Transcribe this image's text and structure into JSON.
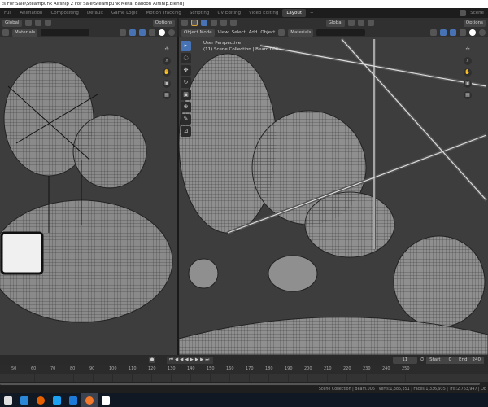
{
  "title": "ts For Sale\\Steampunk Airship 2 For Sale\\Steampunk Metal Balloon Airship.blend]",
  "workspaces": [
    "Full",
    "Animation",
    "Compositing",
    "Default",
    "Game Logic",
    "Motion Tracking",
    "Scripting",
    "UV Editing",
    "Video Editing",
    "Layout"
  ],
  "active_workspace": "Layout",
  "add_tab": "+",
  "scene_label": "Scene",
  "left_header": {
    "orientation": "Global",
    "options": "Options",
    "shading": "Materials"
  },
  "right_header": {
    "orientation": "Global",
    "options": "Options",
    "mode": "Object Mode",
    "menus": [
      "View",
      "Select",
      "Add",
      "Object"
    ],
    "shading": "Materials"
  },
  "viewport_info": {
    "view": "User Perspective",
    "collection": "(11) Scene Collection | Beam.006"
  },
  "timeline": {
    "current_frame": "11",
    "start_label": "Start",
    "start": "0",
    "end_label": "End",
    "end": "240",
    "ticks": [
      "50",
      "60",
      "70",
      "80",
      "90",
      "100",
      "110",
      "120",
      "130",
      "140",
      "150",
      "160",
      "170",
      "180",
      "190",
      "200",
      "210",
      "220",
      "230",
      "240",
      "250"
    ]
  },
  "status": "Scene Collection | Beam.006 | Verts:1,385,351 | Faces:1,336,935 | Tris:2,763,947 | Ob",
  "colors": {
    "accent": "#4772b3",
    "viewport": "#3d3d3d",
    "header": "#303030"
  }
}
